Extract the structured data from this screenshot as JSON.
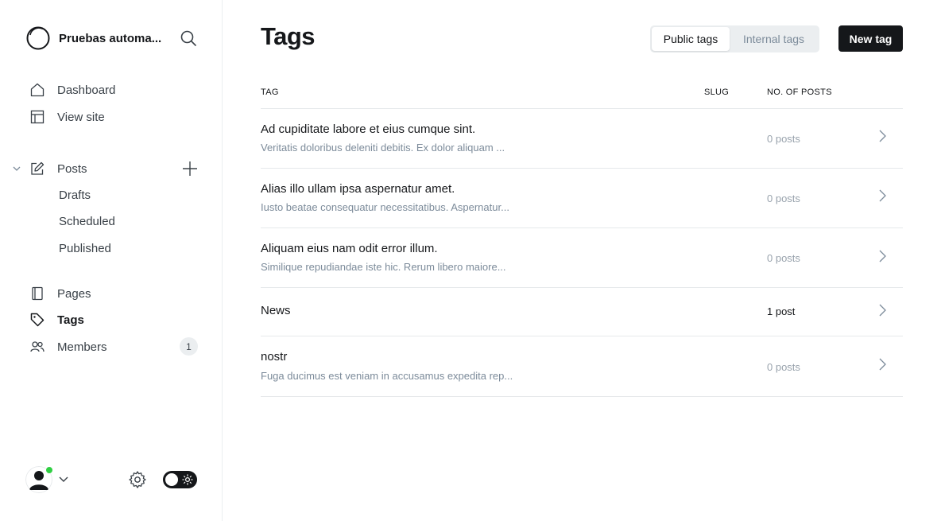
{
  "sidebar": {
    "brand_name": "Pruebas automa...",
    "nav": {
      "dashboard": "Dashboard",
      "view_site": "View site",
      "posts": "Posts",
      "drafts": "Drafts",
      "scheduled": "Scheduled",
      "published": "Published",
      "pages": "Pages",
      "tags": "Tags",
      "members": "Members",
      "members_count": "1"
    }
  },
  "header": {
    "title": "Tags",
    "tabs": [
      "Public tags",
      "Internal tags"
    ],
    "selected_tab": "Public tags",
    "new_tag_label": "New tag"
  },
  "table": {
    "columns": [
      "TAG",
      "SLUG",
      "NO. OF POSTS"
    ],
    "rows": [
      {
        "name": "Ad cupiditate labore et eius cumque sint.",
        "description": "Veritatis doloribus deleniti debitis. Ex dolor aliquam ...",
        "posts": "0 posts"
      },
      {
        "name": "Alias illo ullam ipsa aspernatur amet.",
        "description": "Iusto beatae consequatur necessitatibus. Aspernatur...",
        "posts": "0 posts"
      },
      {
        "name": "Aliquam eius nam odit error illum.",
        "description": "Similique repudiandae iste hic. Rerum libero maiore...",
        "posts": "0 posts"
      },
      {
        "name": "News",
        "description": "",
        "posts": "1 post"
      },
      {
        "name": "nostr",
        "description": "Fuga ducimus est veniam in accusamus expedita rep...",
        "posts": "0 posts"
      }
    ]
  },
  "colors": {
    "accent_dark": "#15171a",
    "status_online": "#30cf43",
    "muted_text": "#7c8b9a"
  },
  "icons": [
    "brand-circle-icon",
    "search-icon",
    "home-icon",
    "layout-icon",
    "chevron-down-icon",
    "edit-icon",
    "plus-icon",
    "page-icon",
    "tag-icon",
    "members-icon",
    "avatar-icon",
    "gear-icon",
    "sun-icon",
    "chevron-right-icon"
  ]
}
